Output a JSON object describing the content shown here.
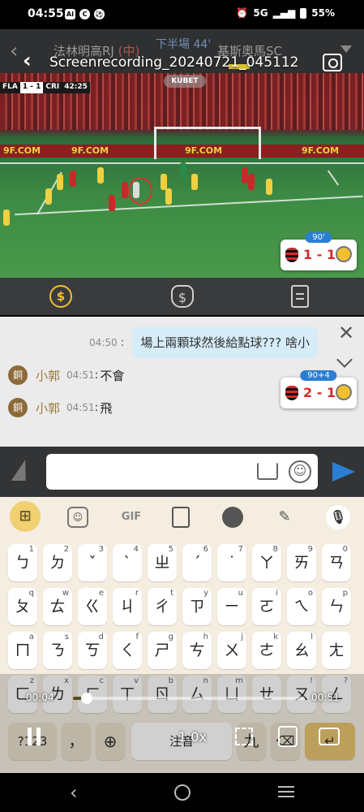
{
  "status_bar": {
    "time": "04:55",
    "notification_icons": [
      "AI",
      "C",
      "⚽"
    ],
    "alarm_icon": "alarm-icon",
    "network": "5G",
    "battery": "55%"
  },
  "header": {
    "team_home": "法林明高RJ",
    "home_tag": "(中)",
    "period": "下半場 44'",
    "team_away": "基斯奧馬SC"
  },
  "recording": {
    "title": "Screenrecording_20240721_045112"
  },
  "video": {
    "watermark": "KUBET",
    "scoreboard": {
      "home": "FLA",
      "score": "1 - 1",
      "away": "CRI",
      "clock": "42:25"
    },
    "ad_text": "9F.COM"
  },
  "score_badges": [
    {
      "minute": "90'",
      "score": "1 - 1"
    },
    {
      "minute": "90+4",
      "score": "2 - 1"
    }
  ],
  "tabs": [
    "coin-icon",
    "money-bag-icon",
    "document-icon"
  ],
  "chat": {
    "self_message": {
      "time": "04:50",
      "text": "場上兩顆球然後給點球??? 啥小"
    },
    "messages": [
      {
        "rank": "銅",
        "user": "小郭",
        "time": "04:51",
        "text": "不會"
      },
      {
        "rank": "銅",
        "user": "小郭",
        "time": "04:51",
        "text": "飛"
      }
    ]
  },
  "keyboard": {
    "toolbar_gif": "GIF",
    "row1": [
      [
        "ㄅ",
        "1"
      ],
      [
        "ㄉ",
        "2"
      ],
      [
        "ˇ",
        "3"
      ],
      [
        "ˋ",
        "4"
      ],
      [
        "ㄓ",
        "5"
      ],
      [
        "ˊ",
        "6"
      ],
      [
        "˙",
        "7"
      ],
      [
        "ㄚ",
        "8"
      ],
      [
        "ㄞ",
        "9"
      ],
      [
        "ㄢ",
        "0"
      ]
    ],
    "row2": [
      [
        "ㄆ",
        "q"
      ],
      [
        "ㄊ",
        "w"
      ],
      [
        "ㄍ",
        "e"
      ],
      [
        "ㄐ",
        "r"
      ],
      [
        "ㄔ",
        "t"
      ],
      [
        "ㄗ",
        "y"
      ],
      [
        "ㄧ",
        "u"
      ],
      [
        "ㄛ",
        "i"
      ],
      [
        "ㄟ",
        "o"
      ],
      [
        "ㄣ",
        "p"
      ]
    ],
    "row3": [
      [
        "ㄇ",
        "a"
      ],
      [
        "ㄋ",
        "s"
      ],
      [
        "ㄎ",
        "d"
      ],
      [
        "ㄑ",
        "f"
      ],
      [
        "ㄕ",
        "g"
      ],
      [
        "ㄘ",
        "h"
      ],
      [
        "ㄨ",
        "j"
      ],
      [
        "ㄜ",
        "k"
      ],
      [
        "ㄠ",
        "l"
      ],
      [
        "ㄤ",
        ""
      ]
    ],
    "row4": [
      [
        "ㄈ",
        "z"
      ],
      [
        "ㄌ",
        "x"
      ],
      [
        "ㄏ",
        "c"
      ],
      [
        "ㄒ",
        "v"
      ],
      [
        "ㄖ",
        "b"
      ],
      [
        "ㄙ",
        "n"
      ],
      [
        "ㄩ",
        "m"
      ],
      [
        "ㄝ",
        ""
      ],
      [
        "ㄡ",
        "!"
      ],
      [
        "ㄥ",
        "?"
      ]
    ],
    "sym_key": "?123",
    "punct_key": "，",
    "space_label": "注音",
    "toggle_key": "九"
  },
  "playback": {
    "elapsed": "00:04",
    "total": "00:51",
    "speed": "1.0x",
    "progress": 0.06
  }
}
